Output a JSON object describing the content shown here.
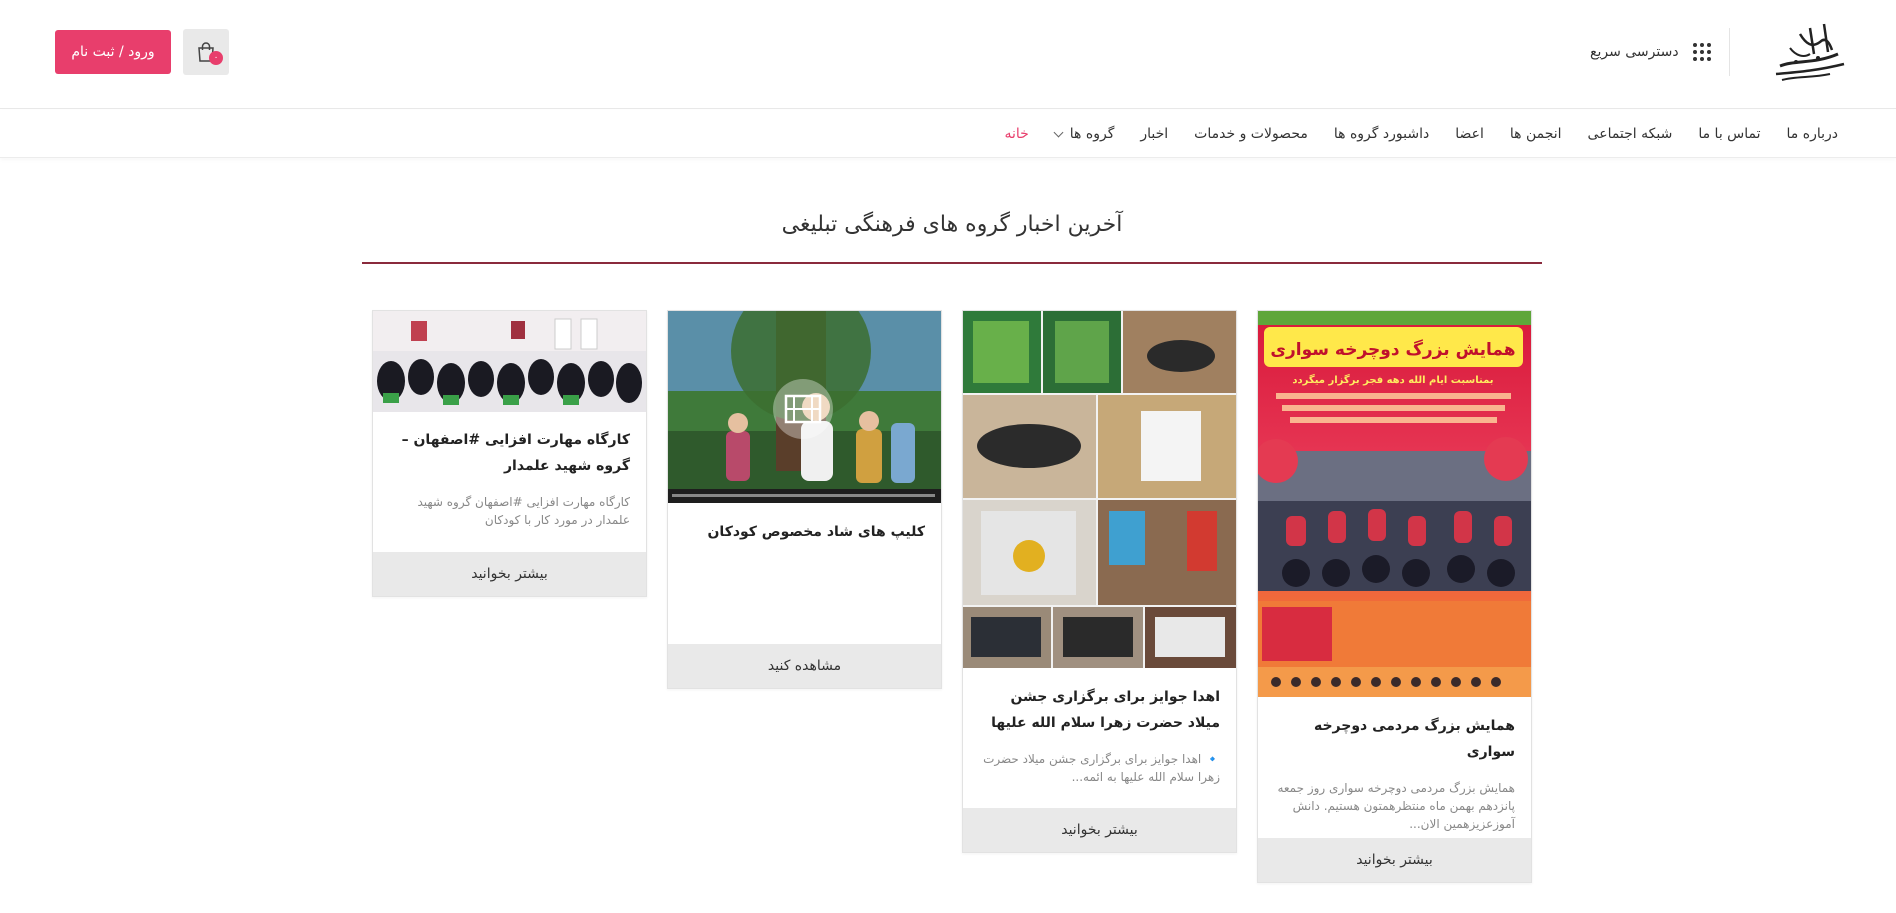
{
  "header": {
    "quick_access_label": "دسترسی سریع",
    "cart_count": "۰",
    "login_label": "ورود / ثبت نام"
  },
  "nav": {
    "items": [
      {
        "label": "خانه"
      },
      {
        "label": "گروه ها"
      },
      {
        "label": "اخبار"
      },
      {
        "label": "محصولات و خدمات"
      },
      {
        "label": "داشبورد گروه ها"
      },
      {
        "label": "اعضا"
      },
      {
        "label": "انجمن ها"
      },
      {
        "label": "شبکه اجتماعی"
      },
      {
        "label": "تماس با ما"
      },
      {
        "label": "درباره ما"
      }
    ]
  },
  "section": {
    "title": "آخرین اخبار گروه های فرهنگی تبلیغی"
  },
  "cards": [
    {
      "title": "همایش بزرگ مردمی دوچرخه سواری",
      "desc": "همایش بزرگ مردمی دوچرخه سواری روز جمعه پانزدهم بهمن ماه منتظرهمتون هستیم. دانش آموزعزیزهمین الان...",
      "button": "بیشتر بخوانید",
      "poster_headline": "همایش بزرگ دوچرخه سواری",
      "poster_sub": "بمناسبت ایام الله دهه فجر برگزار میگردد"
    },
    {
      "title": "اهدا جوایز برای برگزاری جشن میلاد حضرت زهرا سلام الله علیها",
      "desc": "🔹 اهدا جوایز برای برگزاری جشن میلاد حضرت زهرا سلام الله علیها به ائمه...",
      "button": "بیشتر بخوانید"
    },
    {
      "title": "کلیپ های شاد مخصوص کودکان",
      "desc": "",
      "button": "مشاهده کنید"
    },
    {
      "title": "کارگاه مهارت افزایی #اصفهان – گروه شهید علمدار",
      "desc": "کارگاه مهارت افزایی #اصفهان گروه شهید علمدار در مورد کار با کودکان",
      "button": "بیشتر بخوانید"
    }
  ],
  "colors": {
    "accent": "#e83e6c",
    "title_rule": "#8a2a3c",
    "button_bg": "#e9e9e9"
  },
  "icons": {
    "menu": "grid-dots-icon",
    "cart": "shopping-bag-icon",
    "video": "film-icon"
  }
}
